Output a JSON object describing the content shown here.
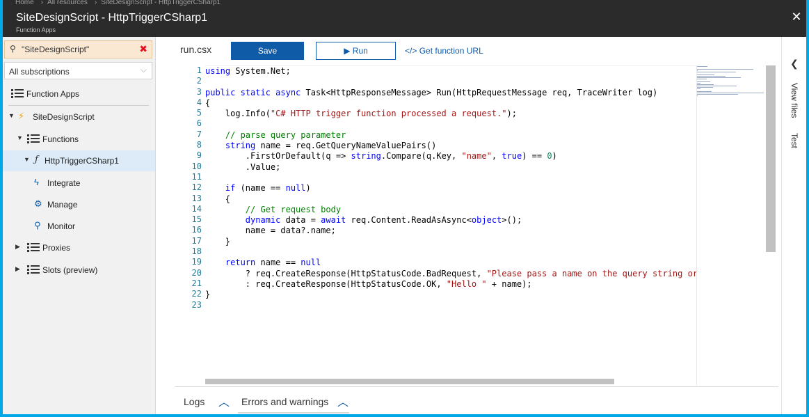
{
  "header": {
    "breadcrumbs": [
      "Home",
      "All resources",
      "SiteDesignScript - HttpTriggerCSharp1"
    ],
    "title": "SiteDesignScript - HttpTriggerCSharp1",
    "subtitle": "Function Apps"
  },
  "sidebar": {
    "search_value": "\"SiteDesignScript\"",
    "subscription": "All subscriptions",
    "items": {
      "function_apps": "Function Apps",
      "app": "SiteDesignScript",
      "functions": "Functions",
      "function": "HttpTriggerCSharp1",
      "integrate": "Integrate",
      "manage": "Manage",
      "monitor": "Monitor",
      "proxies": "Proxies",
      "slots": "Slots (preview)"
    }
  },
  "toolbar": {
    "filename": "run.csx",
    "save_label": "Save",
    "run_label": "Run",
    "function_url_label": "Get function URL"
  },
  "editor": {
    "lines": [
      [
        [
          "kw",
          "using"
        ],
        [
          "t",
          " System.Net;"
        ]
      ],
      [],
      [
        [
          "kw",
          "public static async"
        ],
        [
          "t",
          " Task<HttpResponseMessage> Run(HttpRequestMessage req, TraceWriter log)"
        ]
      ],
      [
        [
          "t",
          "{"
        ]
      ],
      [
        [
          "t",
          "    log.Info("
        ],
        [
          "str",
          "\"C# HTTP trigger function processed a request.\""
        ],
        [
          "t",
          ");"
        ]
      ],
      [],
      [
        [
          "cm",
          "    // parse query parameter"
        ]
      ],
      [
        [
          "t",
          "    "
        ],
        [
          "kw",
          "string"
        ],
        [
          "t",
          " name = req.GetQueryNameValuePairs()"
        ]
      ],
      [
        [
          "t",
          "        .FirstOrDefault(q => "
        ],
        [
          "kw",
          "string"
        ],
        [
          "t",
          ".Compare(q.Key, "
        ],
        [
          "str",
          "\"name\""
        ],
        [
          "t",
          ", "
        ],
        [
          "kw",
          "true"
        ],
        [
          "t",
          ") == "
        ],
        [
          "num",
          "0"
        ],
        [
          "t",
          ")"
        ]
      ],
      [
        [
          "t",
          "        .Value;"
        ]
      ],
      [],
      [
        [
          "t",
          "    "
        ],
        [
          "kw",
          "if"
        ],
        [
          "t",
          " (name == "
        ],
        [
          "kw",
          "null"
        ],
        [
          "t",
          ")"
        ]
      ],
      [
        [
          "t",
          "    {"
        ]
      ],
      [
        [
          "cm",
          "        // Get request body"
        ]
      ],
      [
        [
          "t",
          "        "
        ],
        [
          "kw",
          "dynamic"
        ],
        [
          "t",
          " data = "
        ],
        [
          "kw",
          "await"
        ],
        [
          "t",
          " req.Content.ReadAsAsync<"
        ],
        [
          "kw",
          "object"
        ],
        [
          "t",
          ">();"
        ]
      ],
      [
        [
          "t",
          "        name = data?.name;"
        ]
      ],
      [
        [
          "t",
          "    }"
        ]
      ],
      [],
      [
        [
          "t",
          "    "
        ],
        [
          "kw",
          "return"
        ],
        [
          "t",
          " name == "
        ],
        [
          "kw",
          "null"
        ]
      ],
      [
        [
          "t",
          "        ? req.CreateResponse(HttpStatusCode.BadRequest, "
        ],
        [
          "str",
          "\"Please pass a name on the query string or in the request body\""
        ],
        [
          "t",
          ")"
        ]
      ],
      [
        [
          "t",
          "        : req.CreateResponse(HttpStatusCode.OK, "
        ],
        [
          "str",
          "\"Hello \""
        ],
        [
          "t",
          " + name);"
        ]
      ],
      [
        [
          "t",
          "}"
        ]
      ],
      []
    ]
  },
  "bottom": {
    "logs_label": "Logs",
    "errors_label": "Errors and warnings"
  },
  "right_panel": {
    "view_files_label": "View files",
    "test_label": "Test"
  },
  "colors": {
    "accent": "#0f5ba7",
    "header_bg": "#2b2b2b",
    "frame_border": "#00a8e8",
    "selected_bg": "#dcebf7"
  }
}
